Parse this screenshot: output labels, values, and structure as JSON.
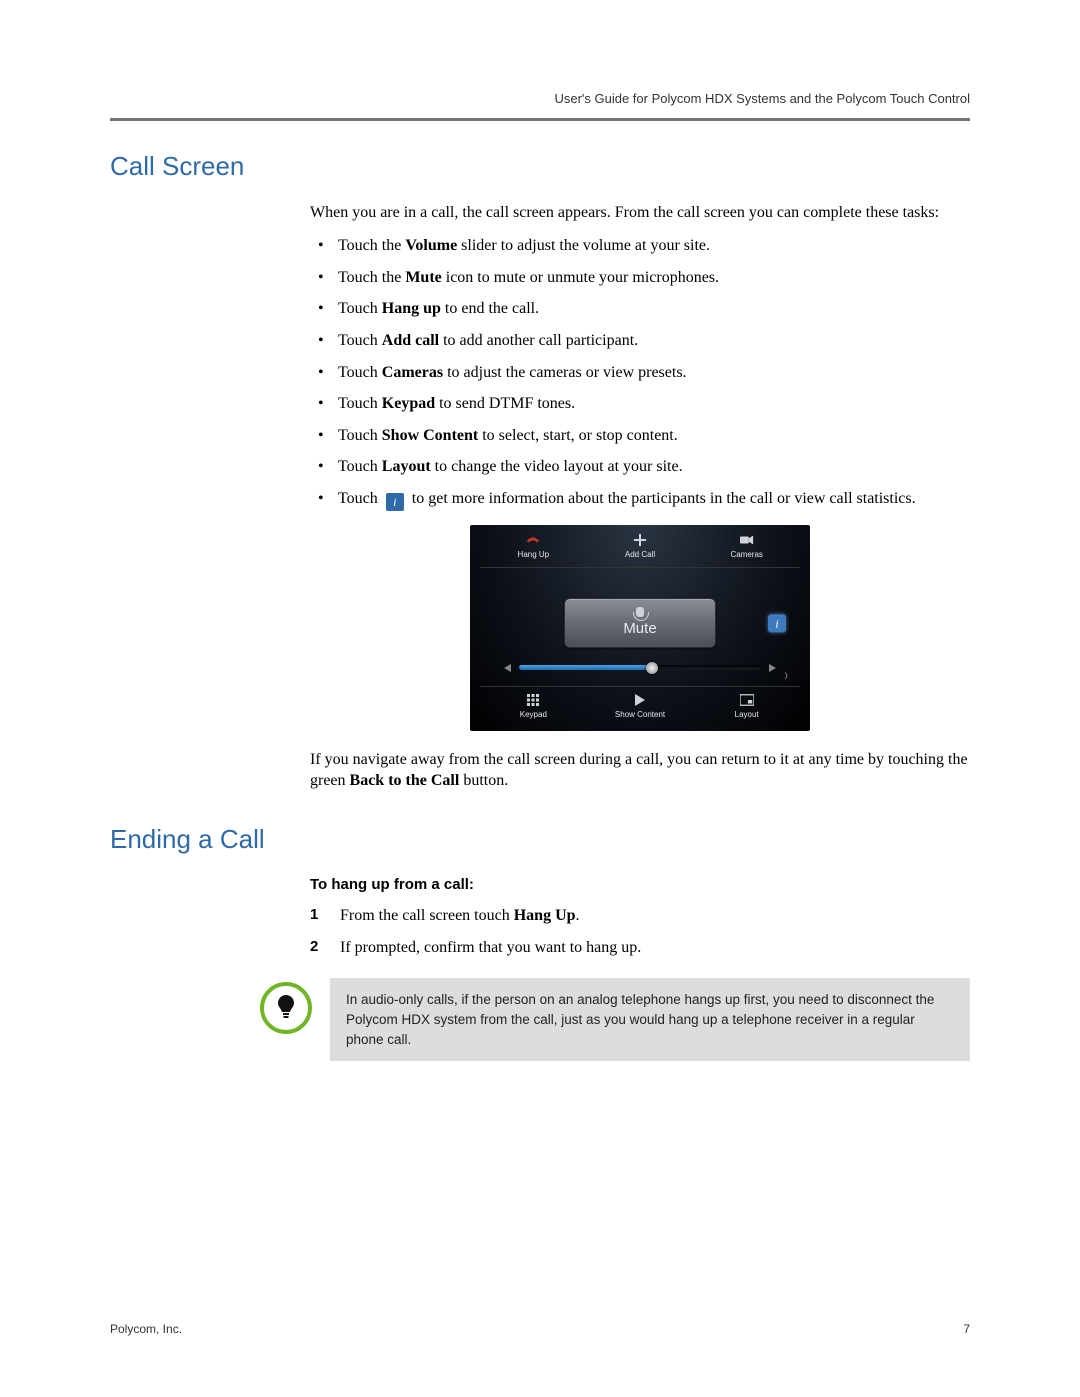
{
  "header": {
    "running_head": "User's Guide for Polycom HDX Systems and the Polycom Touch Control"
  },
  "section1": {
    "title": "Call Screen",
    "intro": "When you are in a call, the call screen appears. From the call screen you can complete these tasks:",
    "bullets": {
      "b0": {
        "pre": "Touch the ",
        "bold": "Volume",
        "post": " slider to adjust the volume at your site."
      },
      "b1": {
        "pre": "Touch the ",
        "bold": "Mute",
        "post": " icon to mute or unmute your microphones."
      },
      "b2": {
        "pre": "Touch ",
        "bold": "Hang up",
        "post": " to end the call."
      },
      "b3": {
        "pre": "Touch ",
        "bold": "Add call",
        "post": " to add another call participant."
      },
      "b4": {
        "pre": "Touch ",
        "bold": "Cameras",
        "post": " to adjust the cameras or view presets."
      },
      "b5": {
        "pre": "Touch ",
        "bold": "Keypad",
        "post": " to send DTMF tones."
      },
      "b6": {
        "pre": "Touch ",
        "bold": "Show Content",
        "post": " to select, start, or stop content."
      },
      "b7": {
        "pre": "Touch ",
        "bold": "Layout",
        "post": " to change the video layout at your site."
      },
      "b8": {
        "pre": "Touch ",
        "icon": "i",
        "post": " to get more information about the participants in the call or view call statistics."
      }
    },
    "after_device_pre": "If you navigate away from the call screen during a call, you can return to it at any time by touching the green ",
    "after_device_bold": "Back to the Call",
    "after_device_post": " button."
  },
  "device": {
    "top": {
      "hangup": "Hang Up",
      "addcall": "Add Call",
      "cameras": "Cameras"
    },
    "mute": "Mute",
    "info": "i",
    "bottom": {
      "keypad": "Keypad",
      "showcontent": "Show Content",
      "layout": "Layout"
    }
  },
  "section2": {
    "title": "Ending a Call",
    "subhead": "To hang up from a call:",
    "steps": {
      "s1": {
        "pre": "From the call screen touch ",
        "bold": "Hang Up",
        "post": "."
      },
      "s2": {
        "text": "If prompted, confirm that you want to hang up."
      }
    },
    "note": "In audio-only calls, if the person on an analog telephone hangs up first, you need to disconnect the Polycom HDX system from the call, just as you would hang up a telephone receiver in a regular phone call."
  },
  "footer": {
    "left": "Polycom, Inc.",
    "right": "7"
  }
}
